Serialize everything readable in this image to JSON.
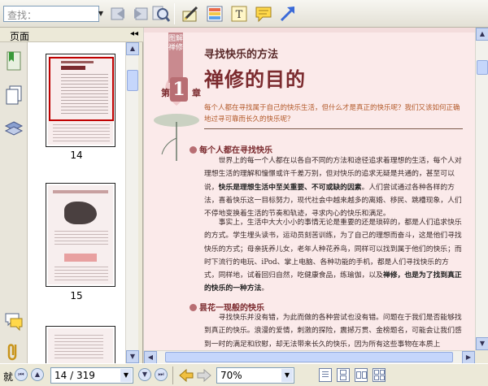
{
  "toolbar": {
    "search_placeholder": "查找：",
    "icons": [
      "prev-match-icon",
      "next-match-icon",
      "find-icon",
      "highlight-pen-icon",
      "draw-icon",
      "text-box-icon",
      "note-icon",
      "arrow-icon"
    ]
  },
  "left_panel": {
    "title": "页面",
    "tabs": [
      "bookmarks-icon",
      "pages-icon",
      "layers-icon",
      "comments-icon",
      "attachments-icon"
    ],
    "thumbnails": [
      {
        "label": "14",
        "selected": true
      },
      {
        "label": "15",
        "selected": false
      }
    ]
  },
  "document": {
    "side_label": "图解禅修",
    "small_title": "寻找快乐的方法",
    "big_title": "禅修的目的",
    "chapter_pre": "第",
    "chapter_num": "1",
    "chapter_post": "章",
    "intro": "每个人都在寻找属于自己的快乐生活，但什么才是真正的快乐呢？我们又该如何正确地过寻可靠而长久的快乐呢？",
    "section1_title": "每个人都在寻找快乐",
    "para1_a": "世界上的每一个人都在以各自不同的方法和途径追求着理想的生活，每个人对理想生活的理解和憧憬或许千差万别，但对快乐的追求无疑是共通的，甚至可以说，",
    "para1_bold": "快乐是理想生活中至关重要、不可或缺的因素",
    "para1_b": "。人们尝试通过各种各样的方法，喜着快乐这一目标努力，现代社会中越来越多的离婚、移民、跳槽现象，人们不停地变换着生活的节奏和轨迹，寻求内心的快乐和满足。",
    "para2_a": "事实上，生活中大大小小的事情无论是重要的还是琐碎的，都是人们追求快乐的方式。学生埋头读书，运动员刻苦训练，为了自己的理想而奋斗，这是他们寻找快乐的方式；母亲抚养儿女，老年人种花养鸟，同样可以找到属于他们的快乐；而时下流行的电玩、iPod、掌上电脑、各种功能的手机，都是人们寻找快乐的方式，同样地，试着回归自然，吃健康食品，练瑜伽，以及",
    "para2_bold": "禅修，也是为了找到真正的快乐的一种方法",
    "para2_b": "。",
    "section2_title": "昙花一现般的快乐",
    "para3": "寻找快乐并没有错，为此而做的各种尝试也没有错。问题在于我们是否能够找到真正的快乐。浪漫的爱情，刺激的探险，震撼万贯、金榜题名，可能会让我们感到一时的满足和欣慰，却无法带来长久的快乐，因为所有这些事物在本质上"
  },
  "statusbar": {
    "ready": "就",
    "page_indicator": "14 / 319",
    "zoom": "70%"
  },
  "colors": {
    "page_bg": "#fbeaea",
    "accent": "#7b2a2e",
    "intro_text": "#b35a2a",
    "selection": "#c00000"
  }
}
